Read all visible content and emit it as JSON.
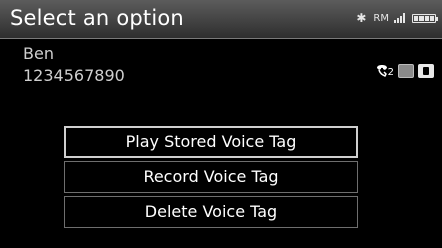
{
  "header": {
    "title": "Select an option",
    "status": {
      "bluetooth": "✱",
      "roaming": "RM"
    }
  },
  "contact": {
    "name": "Ben",
    "number": "1234567890",
    "line_number": "2"
  },
  "menu": {
    "items": [
      {
        "label": "Play Stored Voice Tag"
      },
      {
        "label": "Record Voice Tag"
      },
      {
        "label": "Delete Voice Tag"
      }
    ]
  },
  "icons": {
    "bluetooth": "bluetooth-icon",
    "signal": "signal-strength-icon",
    "battery": "battery-icon",
    "handset": "phone-handset-icon",
    "hands_free": "hands-free-icon",
    "phone_device": "phone-device-icon"
  }
}
